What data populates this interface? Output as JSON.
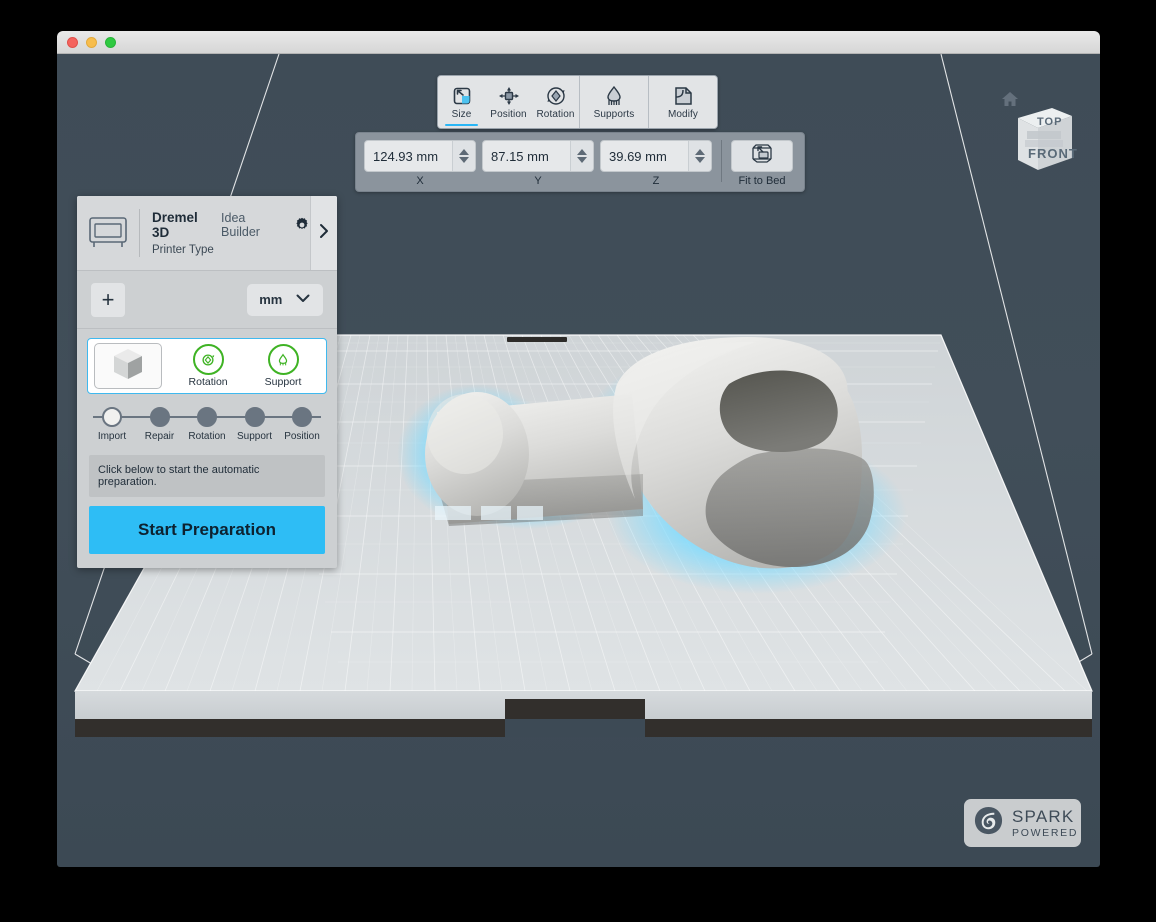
{
  "window": {
    "traffic_lights": [
      "close",
      "minimize",
      "zoom"
    ]
  },
  "toolbar": {
    "groups": [
      {
        "tabs": [
          {
            "label": "Size",
            "icon": "resize-icon",
            "active": true
          },
          {
            "label": "Position",
            "icon": "move-icon",
            "active": false
          },
          {
            "label": "Rotation",
            "icon": "rotate-icon",
            "active": false
          }
        ]
      },
      {
        "tabs": [
          {
            "label": "Supports",
            "icon": "supports-icon",
            "active": false
          }
        ]
      },
      {
        "tabs": [
          {
            "label": "Modify",
            "icon": "modify-icon",
            "active": false
          }
        ]
      }
    ]
  },
  "dimensions": {
    "fields": [
      {
        "axis": "X",
        "value": "124.93 mm"
      },
      {
        "axis": "Y",
        "value": "87.15 mm"
      },
      {
        "axis": "Z",
        "value": "39.69 mm"
      }
    ],
    "fit_to_bed": {
      "label": "Fit to Bed",
      "icon": "fit-to-bed-icon"
    }
  },
  "panel": {
    "printer": {
      "brand": "Dremel 3D",
      "model": "Idea Builder",
      "subtitle": "Printer Type",
      "settings_icon": "gear-icon",
      "expand_icon": "chevron-right-icon",
      "printer_icon": "printer-icon"
    },
    "add_button": {
      "label": "+",
      "icon": "plus-icon"
    },
    "units": {
      "value": "mm",
      "icon": "chevron-down-icon"
    },
    "model_card": {
      "thumbnail_icon": "cube-thumbnail",
      "statuses": [
        {
          "label": "Rotation",
          "icon": "rotation-status-icon",
          "color": "#3fb324"
        },
        {
          "label": "Support",
          "icon": "support-status-icon",
          "color": "#3fb324"
        }
      ]
    },
    "steps": [
      {
        "label": "Import",
        "current": true
      },
      {
        "label": "Repair",
        "current": false
      },
      {
        "label": "Rotation",
        "current": false
      },
      {
        "label": "Support",
        "current": false
      },
      {
        "label": "Position",
        "current": false
      }
    ],
    "hint": "Click below to start the automatic preparation.",
    "start_button": "Start Preparation"
  },
  "viewport": {
    "home_icon": "home-icon",
    "view_cube": {
      "top_label": "TOP",
      "front_label": "FRONT"
    },
    "model": {
      "name": "hook-model",
      "selection_glow_color": "#7fdcff"
    },
    "background_color": "#3f4c57",
    "build_plate_color": "#d5d8da"
  },
  "branding": {
    "title": "SPARK",
    "subtitle": "POWERED",
    "logo_icon": "spark-logo-icon"
  }
}
